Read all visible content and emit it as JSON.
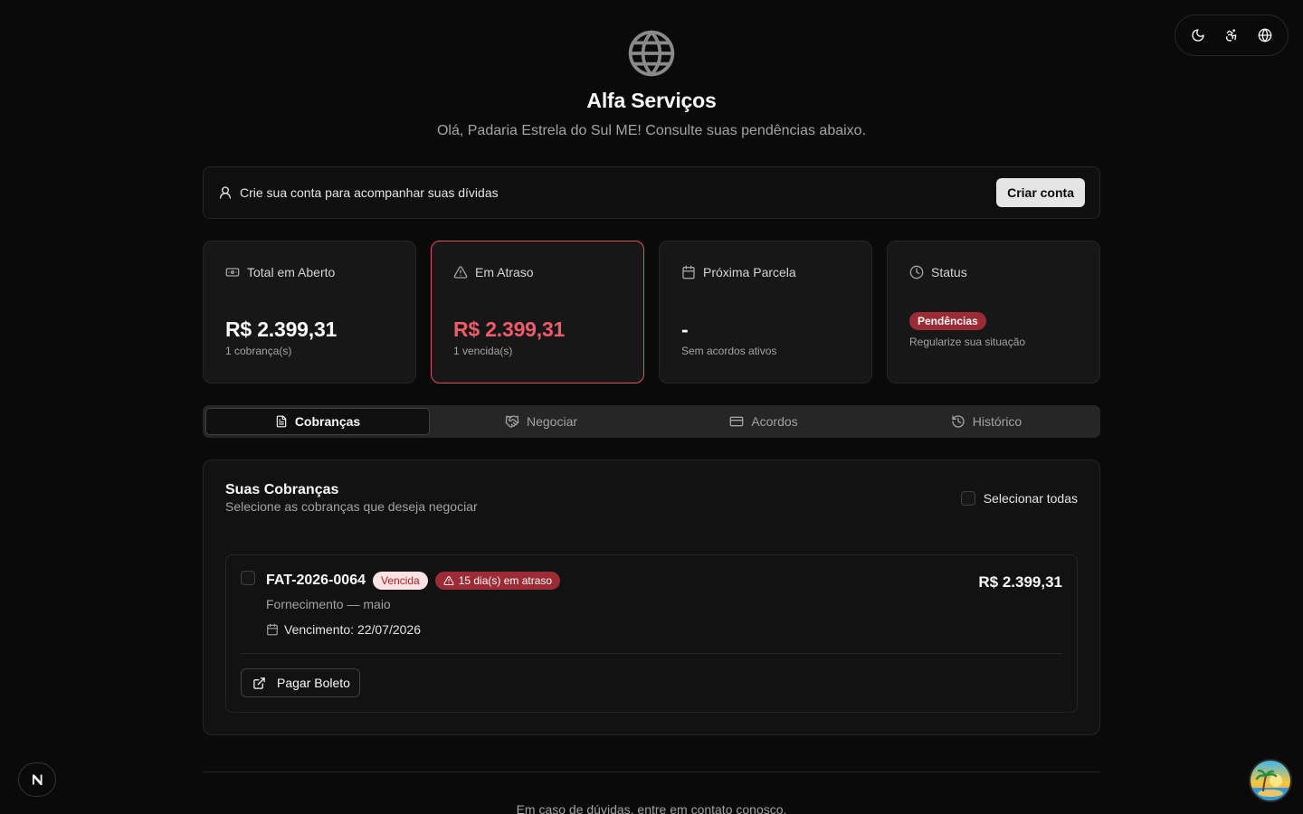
{
  "header": {
    "title": "Alfa Serviços",
    "subtitle": "Olá, Padaria Estrela do Sul ME! Consulte suas pendências abaixo."
  },
  "top_controls": {
    "icons": [
      "moon-icon",
      "accessibility-icon",
      "globe-icon"
    ]
  },
  "banner": {
    "text": "Crie sua conta para acompanhar suas dívidas",
    "button_label": "Criar conta"
  },
  "cards": [
    {
      "label": "Total em Aberto",
      "value": "R$ 2.399,31",
      "sub": "1 cobrança(s)",
      "icon": "banknote-icon"
    },
    {
      "label": "Em Atraso",
      "value": "R$ 2.399,31",
      "sub": "1 vencida(s)",
      "icon": "alert-triangle-icon",
      "accent": "#ef5b6a"
    },
    {
      "label": "Próxima Parcela",
      "value": "-",
      "sub": "Sem acordos ativos",
      "icon": "calendar-icon"
    },
    {
      "label": "Status",
      "badge": "Pendências",
      "sub": "Regularize sua situação",
      "icon": "clock-icon"
    }
  ],
  "tabs": [
    {
      "label": "Cobranças",
      "icon": "file-text-icon",
      "active": true
    },
    {
      "label": "Negociar",
      "icon": "handshake-icon",
      "active": false
    },
    {
      "label": "Acordos",
      "icon": "credit-card-icon",
      "active": false
    },
    {
      "label": "Histórico",
      "icon": "history-icon",
      "active": false
    }
  ],
  "charges_panel": {
    "title": "Suas Cobranças",
    "subtitle": "Selecione as cobranças que deseja negociar",
    "select_all_label": "Selecionar todas",
    "items": [
      {
        "code": "FAT-2026-0064",
        "status_badge": "Vencida",
        "overdue_badge": "15 dia(s) em atraso",
        "description": "Fornecimento — maio",
        "due_label": "Vencimento: 22/07/2026",
        "amount": "R$ 2.399,31",
        "pay_button_label": "Pagar Boleto"
      }
    ]
  },
  "footer": {
    "text": "Em caso de dúvidas, entre em contato conosco."
  },
  "colors": {
    "background": "#0a0a0a",
    "card": "#171717",
    "danger": "#ef5b6a",
    "danger_badge": "#9b2c35"
  }
}
